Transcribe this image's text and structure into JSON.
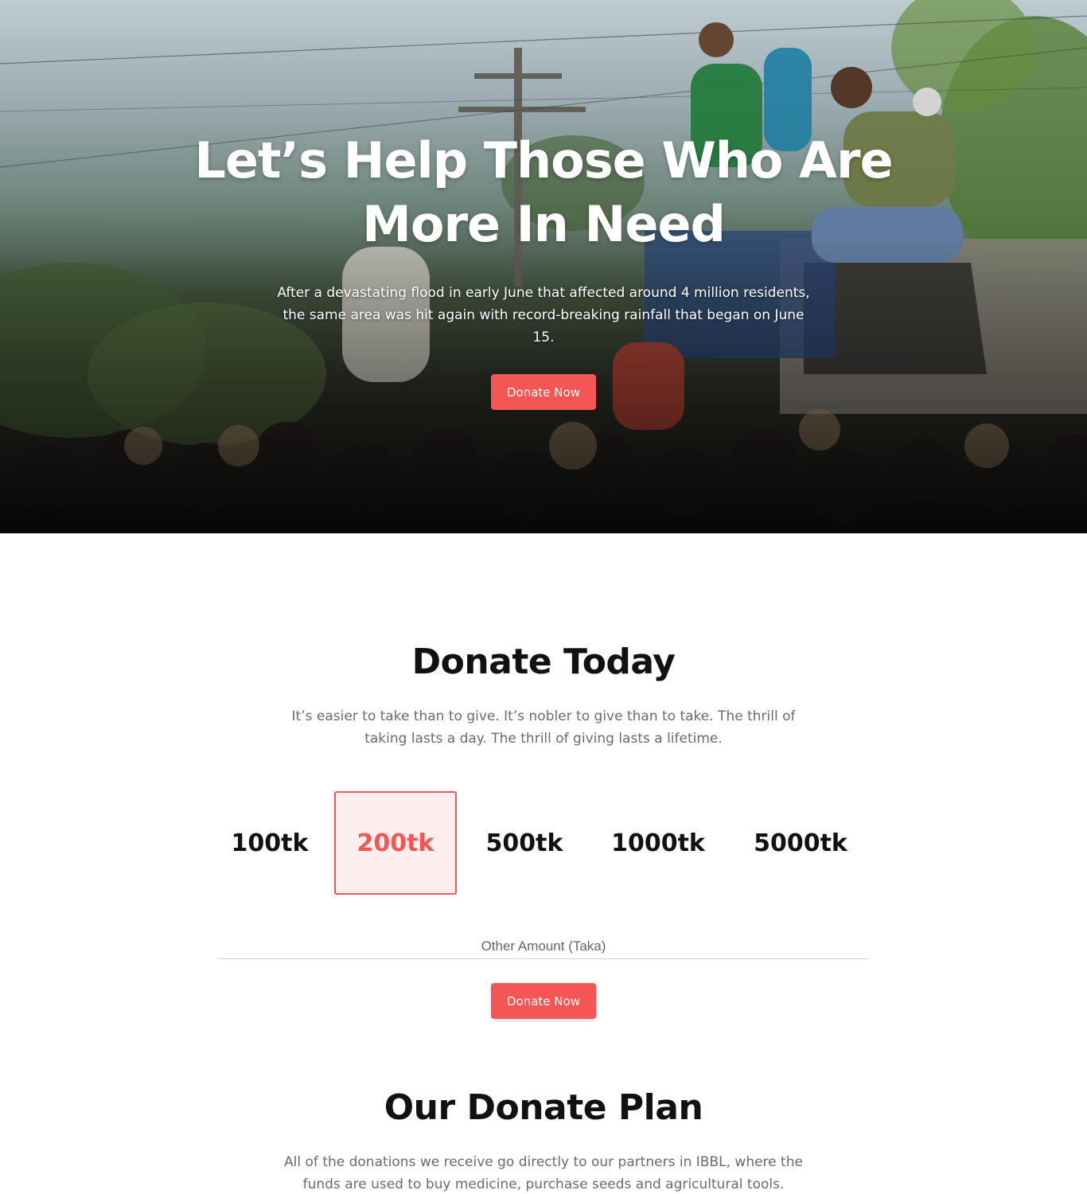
{
  "hero": {
    "title": "Let’s Help Those Who Are More In Need",
    "text": "After a devastating flood in early June that affected around 4 million residents, the same area was hit again with record-breaking rainfall that began on June 15.",
    "button_label": "Donate Now"
  },
  "donate_today": {
    "title": "Donate Today",
    "text": "It’s easier to take than to give. It’s nobler to give than to take. The thrill of taking lasts a day. The thrill of giving lasts a lifetime.",
    "amounts": [
      "100tk",
      "200tk",
      "500tk",
      "1000tk",
      "5000tk"
    ],
    "selected_amount": "200tk",
    "other_amount_placeholder": "Other Amount (Taka)",
    "button_label": "Donate Now"
  },
  "donate_plan": {
    "title": "Our Donate Plan",
    "text": "All of the donations we receive go directly to our partners in IBBL, where the funds are used to buy medicine, purchase seeds and agricultural tools."
  },
  "colors": {
    "accent": "#f45656",
    "selected_bg": "#fdeeee",
    "heading": "#111111",
    "body_text": "#6b6b6b"
  }
}
